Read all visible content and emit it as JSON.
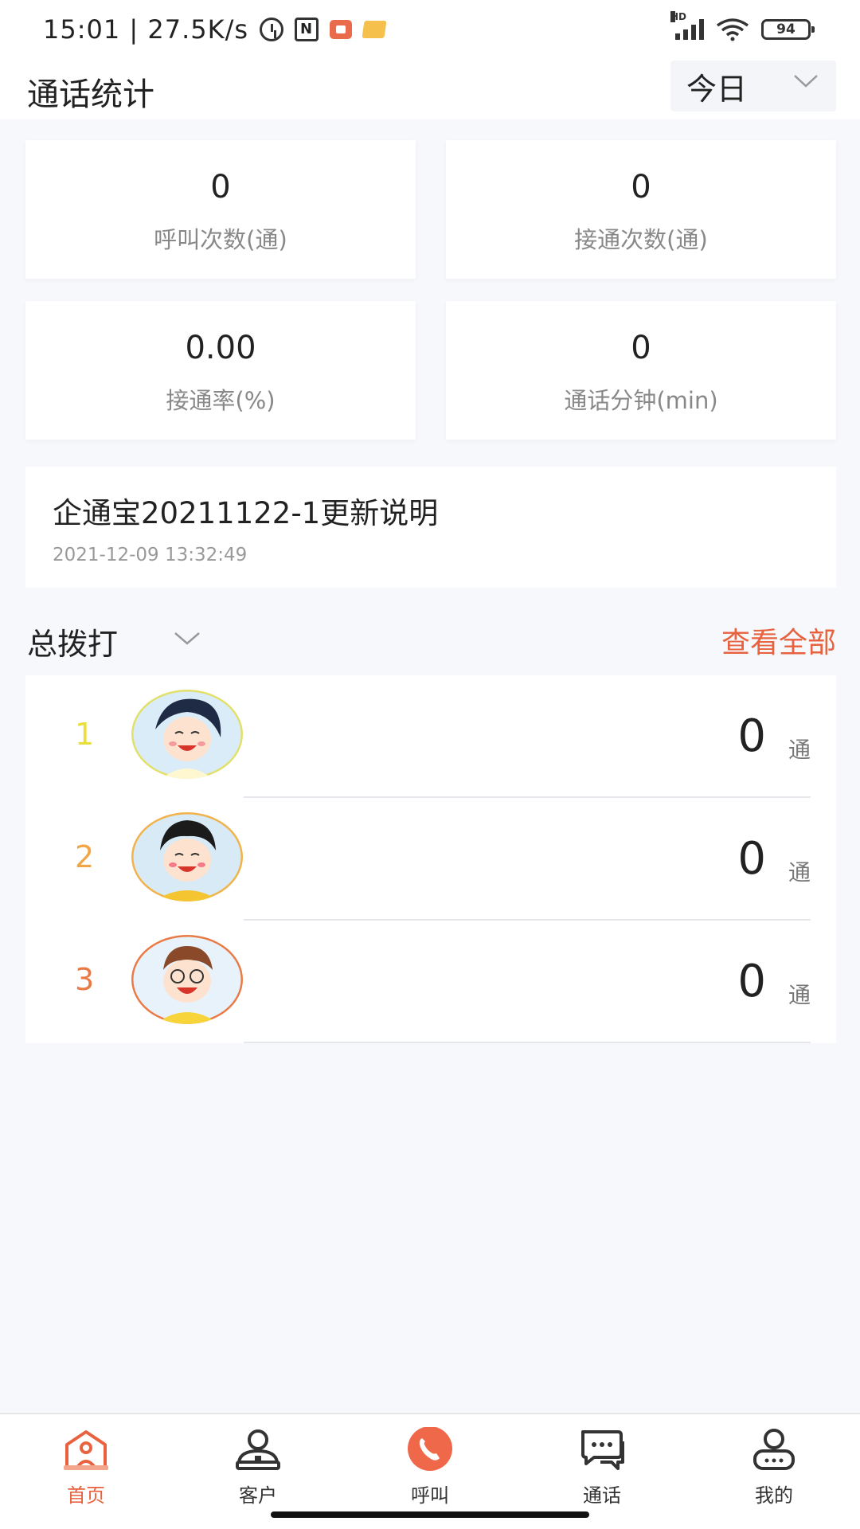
{
  "status_bar": {
    "time_speed": "15:01 | 27.5K/s",
    "battery": "94",
    "network": "HD"
  },
  "header": {
    "title": "通话统计",
    "period": "今日"
  },
  "stats": [
    {
      "value": "0",
      "label": "呼叫次数(通)"
    },
    {
      "value": "0",
      "label": "接通次数(通)"
    },
    {
      "value": "0.00",
      "label": "接通率(%)"
    },
    {
      "value": "0",
      "label": "通话分钟(min)"
    }
  ],
  "notice": {
    "title": "企通宝20211122-1更新说明",
    "time": "2021-12-09 13:32:49"
  },
  "ranking": {
    "filter": "总拨打",
    "view_all": "查看全部",
    "rows": [
      {
        "rank": "1",
        "count": "0",
        "unit": "通",
        "rank_color": "#eadf3a"
      },
      {
        "rank": "2",
        "count": "0",
        "unit": "通",
        "rank_color": "#f2a544"
      },
      {
        "rank": "3",
        "count": "0",
        "unit": "通",
        "rank_color": "#ea7a45"
      }
    ]
  },
  "nav": {
    "items": [
      {
        "label": "首页",
        "icon": "home-icon",
        "active": true
      },
      {
        "label": "客户",
        "icon": "customer-icon",
        "active": false
      },
      {
        "label": "呼叫",
        "icon": "phone-icon",
        "active": false
      },
      {
        "label": "通话",
        "icon": "chat-icon",
        "active": false
      },
      {
        "label": "我的",
        "icon": "profile-icon",
        "active": false
      }
    ]
  },
  "colors": {
    "accent": "#e8623f",
    "background": "#f6f8fc"
  }
}
